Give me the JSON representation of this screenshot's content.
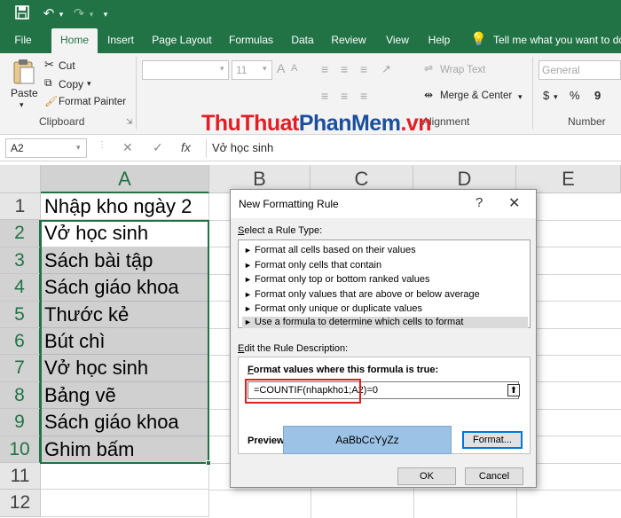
{
  "tabs": [
    "File",
    "Home",
    "Insert",
    "Page Layout",
    "Formulas",
    "Data",
    "Review",
    "View",
    "Help"
  ],
  "tell_me": "Tell me what you want to do",
  "clipboard": {
    "paste": "Paste",
    "cut": "Cut",
    "copy": "Copy",
    "format_painter": "Format Painter",
    "group": "Clipboard"
  },
  "font": {
    "size": "11"
  },
  "alignment": {
    "wrap_text": "Wrap Text",
    "merge_center": "Merge & Center",
    "group_fragment": "Alignment"
  },
  "number": {
    "format": "General",
    "group": "Number",
    "currency_symbol": "$",
    "percent_symbol": "%",
    "comma_symbol": "9"
  },
  "watermark": {
    "part1": "ThuThuat",
    "part2": "PhanMem",
    "part3": ".vn"
  },
  "formula_bar": {
    "name_box": "A2",
    "content": "Vở học sinh",
    "fx": "fx"
  },
  "columns": [
    "A",
    "B",
    "C",
    "D",
    "E"
  ],
  "rows": [
    "1",
    "2",
    "3",
    "4",
    "5",
    "6",
    "7",
    "8",
    "9",
    "10",
    "11",
    "12"
  ],
  "cells": [
    "Nhập kho ngày 2",
    "Vở học sinh",
    "Sách bài tập",
    "Sách giáo khoa",
    "Thước kẻ",
    "Bút chì",
    "Vở học sinh",
    "Bảng vẽ",
    "Sách giáo khoa",
    "Ghim bấm"
  ],
  "dialog": {
    "title": "New Formatting Rule",
    "help": "?",
    "select_rule_type_prefix": "S",
    "select_rule_type_rest": "elect a Rule Type:",
    "rule_types": [
      "Format all cells based on their values",
      "Format only cells that contain",
      "Format only top or bottom ranked values",
      "Format only values that are above or below average",
      "Format only unique or duplicate values",
      "Use a formula to determine which cells to format"
    ],
    "edit_prefix": "E",
    "edit_rest": "dit the Rule Description:",
    "formula_label_prefix": "F",
    "formula_label_rest": "ormat values where this formula is true:",
    "formula": "=COUNTIF(nhapkho1;A2)=0",
    "preview_label": "Preview:",
    "preview_text": "AaBbCcYyZz",
    "format_button": "Format...",
    "ok": "OK",
    "cancel": "Cancel"
  },
  "colors": {
    "excel_green": "#217346",
    "preview_fill": "#9cc3e6",
    "highlight_red": "#e02020"
  }
}
